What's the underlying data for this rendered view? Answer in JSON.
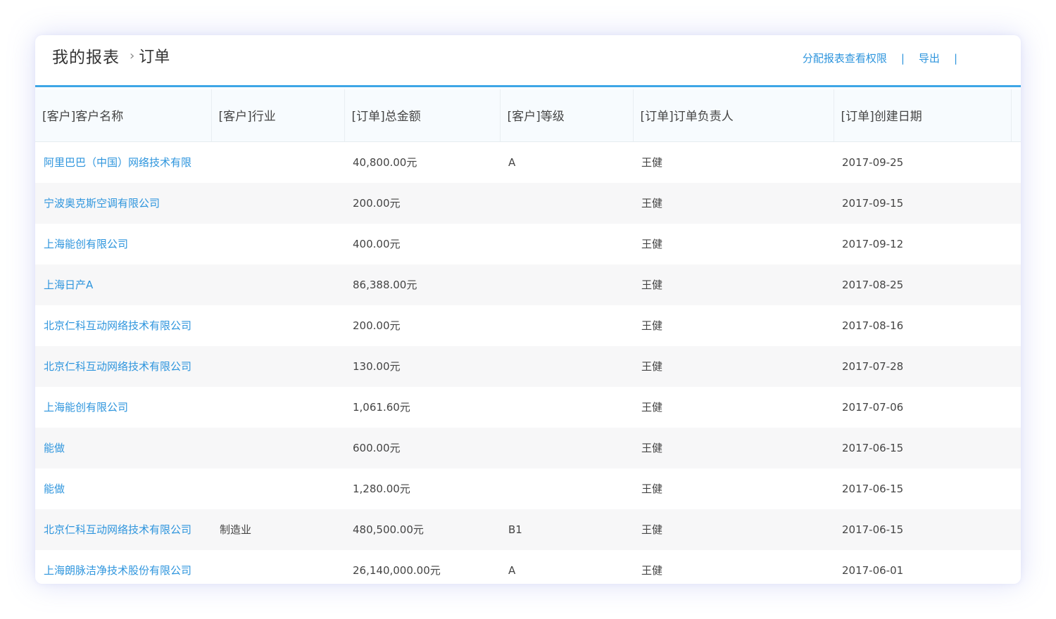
{
  "breadcrumb": {
    "root": "我的报表",
    "separator": "›",
    "current": "订单"
  },
  "actions": {
    "assign_permission": "分配报表查看权限",
    "export": "导出",
    "divider": "|"
  },
  "table": {
    "columns": [
      "[客户]客户名称",
      "[客户]行业",
      "[订单]总金额",
      "[客户]等级",
      "[订单]订单负责人",
      "[订单]创建日期"
    ],
    "rows": [
      {
        "customer": "阿里巴巴（中国）网络技术有限",
        "industry": "",
        "amount": "40,800.00元",
        "level": "A",
        "owner": "王健",
        "date": "2017-09-25"
      },
      {
        "customer": "宁波奥克斯空调有限公司",
        "industry": "",
        "amount": "200.00元",
        "level": "",
        "owner": "王健",
        "date": "2017-09-15"
      },
      {
        "customer": "上海能创有限公司",
        "industry": "",
        "amount": "400.00元",
        "level": "",
        "owner": "王健",
        "date": "2017-09-12"
      },
      {
        "customer": "上海日产A",
        "industry": "",
        "amount": "86,388.00元",
        "level": "",
        "owner": "王健",
        "date": "2017-08-25"
      },
      {
        "customer": "北京仁科互动网络技术有限公司",
        "industry": "",
        "amount": "200.00元",
        "level": "",
        "owner": "王健",
        "date": "2017-08-16"
      },
      {
        "customer": "北京仁科互动网络技术有限公司",
        "industry": "",
        "amount": "130.00元",
        "level": "",
        "owner": "王健",
        "date": "2017-07-28"
      },
      {
        "customer": "上海能创有限公司",
        "industry": "",
        "amount": "1,061.60元",
        "level": "",
        "owner": "王健",
        "date": "2017-07-06"
      },
      {
        "customer": "能做",
        "industry": "",
        "amount": "600.00元",
        "level": "",
        "owner": "王健",
        "date": "2017-06-15"
      },
      {
        "customer": "能做",
        "industry": "",
        "amount": "1,280.00元",
        "level": "",
        "owner": "王健",
        "date": "2017-06-15"
      },
      {
        "customer": "北京仁科互动网络技术有限公司",
        "industry": "制造业",
        "amount": "480,500.00元",
        "level": "B1",
        "owner": "王健",
        "date": "2017-06-15"
      },
      {
        "customer": "上海朗脉洁净技术股份有限公司",
        "industry": "",
        "amount": "26,140,000.00元",
        "level": "A",
        "owner": "王健",
        "date": "2017-06-01"
      }
    ]
  },
  "colors": {
    "accent": "#2e95dd",
    "header_rule": "#3ea6e6",
    "zebra": "#f7f7f8",
    "shadow": "#828ce6"
  }
}
